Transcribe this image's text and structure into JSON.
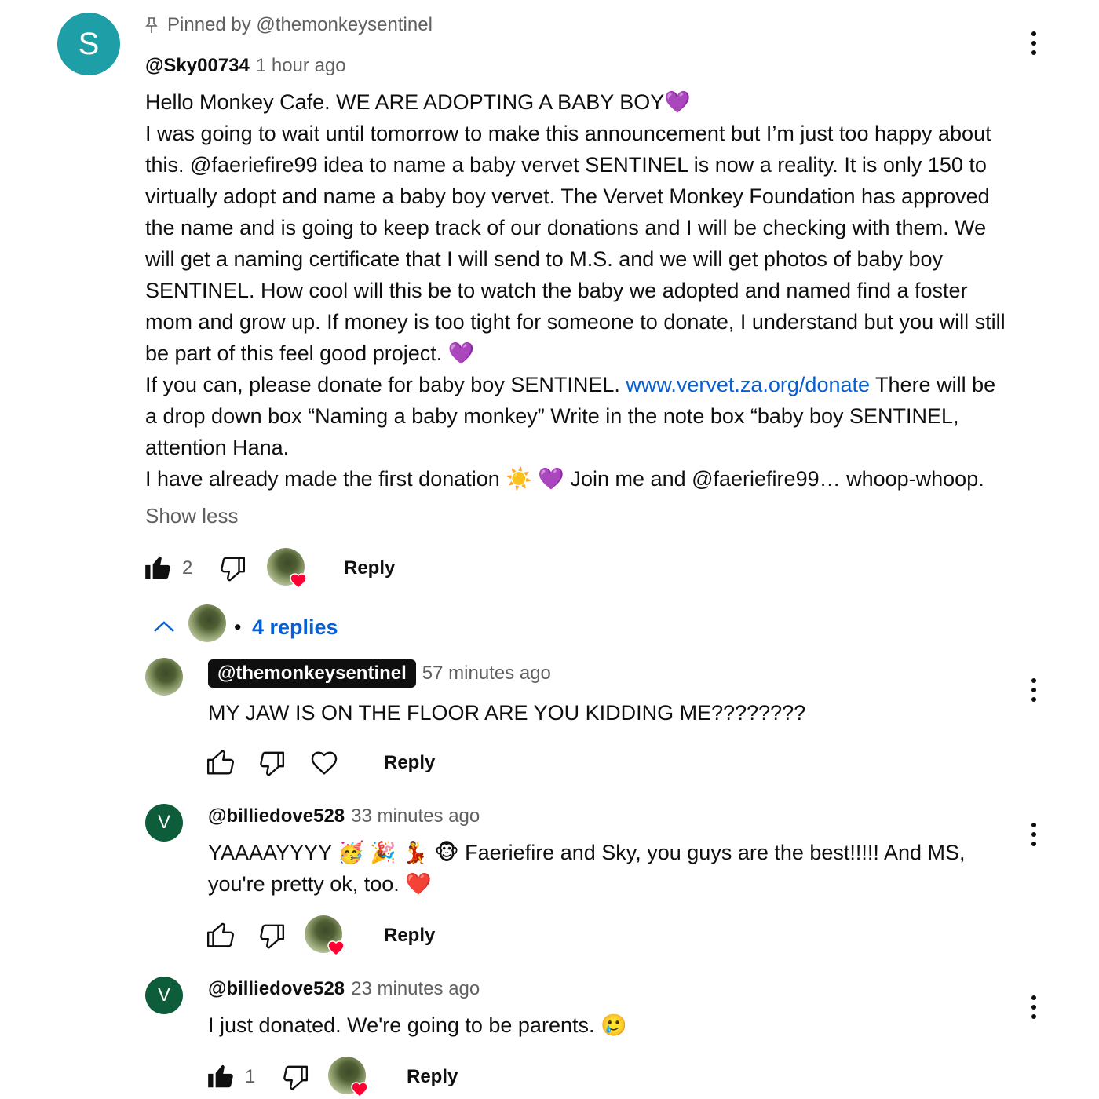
{
  "pinned": {
    "label": "Pinned by @themonkeysentinel",
    "icon": "pin-icon"
  },
  "main_comment": {
    "avatar_letter": "S",
    "avatar_color": "#1e9ea6",
    "author": "@Sky00734",
    "time": "1 hour ago",
    "lines": [
      "Hello Monkey Cafe.  WE ARE ADOPTING A BABY BOY💜",
      "I was going to wait until tomorrow to make this announcement but I’m just too happy about this.  @faeriefire99 idea to name a baby vervet SENTINEL is now a reality. It is only 150 to virtually adopt and name a baby boy vervet. The Vervet Monkey Foundation has approved the name and is going to keep track of our donations and I will be checking with them. We will get a naming certificate that I will send to M.S. and we will get photos of baby boy SENTINEL.  How cool will this be to watch the baby we adopted and named find a foster mom and grow up. If money is too tight for someone to donate, I understand but you will still be part of this feel good project. 💜"
    ],
    "donate_prefix": "If you can, please donate for baby boy SENTINEL. ",
    "donate_link": "www.vervet.za.org/donate",
    "donate_suffix": "  There will be a drop down box “Naming a baby monkey” Write in the note box “baby boy SENTINEL, attention Hana.",
    "last_line": "I have already made the first donation ☀️ 💜  Join me and @faeriefire99… whoop-whoop.",
    "show_less": "Show less",
    "likes": "2",
    "reply_label": "Reply"
  },
  "replies_toggle": {
    "bullet": "•",
    "label": "4 replies"
  },
  "replies": [
    {
      "author": "@themonkeysentinel",
      "time": "57 minutes ago",
      "text": "MY JAW IS ON THE FLOOR ARE YOU KIDDING ME????????",
      "reply_label": "Reply"
    },
    {
      "avatar_letter": "V",
      "avatar_color": "#0d5c3a",
      "author": "@billiedove528",
      "time": "33 minutes ago",
      "text": "YAAAAYYYY 🥳 🎉 💃 🐵  Faeriefire and Sky, you guys are the best!!!!!  And MS, you're pretty ok, too. ❤️",
      "reply_label": "Reply"
    },
    {
      "avatar_letter": "V",
      "avatar_color": "#0d5c3a",
      "author": "@billiedove528",
      "time": "23 minutes ago",
      "text": "I just donated.  We're going to be parents. 🥲",
      "likes": "1",
      "reply_label": "Reply"
    }
  ],
  "colors": {
    "link": "#065fd4",
    "secondary_text": "#606060",
    "heart": "#ff0033"
  }
}
